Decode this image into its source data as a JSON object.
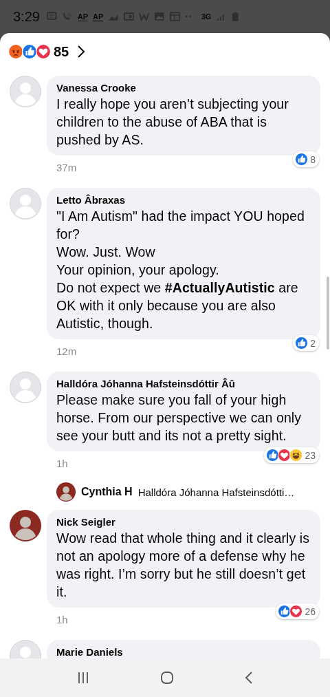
{
  "status_bar": {
    "time": "3:29",
    "ap_labels": [
      "AP",
      "AP"
    ],
    "network": "3G"
  },
  "header": {
    "reactions": [
      {
        "kind": "angry"
      },
      {
        "kind": "like"
      },
      {
        "kind": "love"
      }
    ],
    "count": "85"
  },
  "comments": [
    {
      "author": "Vanessa Crooke",
      "avatar": {
        "kind": "default"
      },
      "text": "I really hope you aren’t subjecting your children to the abuse of ABA that is pushed by AS.",
      "time": "37m",
      "reactions": [
        {
          "kind": "like"
        }
      ],
      "reaction_count": "8"
    },
    {
      "author": "Letto Âbraxas",
      "avatar": {
        "kind": "default"
      },
      "text": "\"I Am Autism\" had the impact YOU hoped for?\nWow. Just. Wow\nYour opinion, your apology.\nDo not expect we **#ActuallyAutistic** are OK with it only because you are also Autistic, though.",
      "time": "12m",
      "reactions": [
        {
          "kind": "like"
        }
      ],
      "reaction_count": "2"
    },
    {
      "author": "Halldóra Jóhanna Hafsteinsdóttir Âû",
      "avatar": {
        "kind": "default"
      },
      "text": "Please make sure you fall of your high horse. From our perspective we can only see your butt and its not a pretty sight.",
      "time": "1h",
      "reactions": [
        {
          "kind": "like"
        },
        {
          "kind": "love"
        },
        {
          "kind": "haha"
        }
      ],
      "reaction_count": "23",
      "reply": {
        "author": "Cynthia H",
        "avatar": {
          "kind": "photo"
        },
        "text": "Halldóra Jóhanna Hafsteinsdótti…"
      }
    },
    {
      "author": "Nick Seigler",
      "avatar": {
        "kind": "photo"
      },
      "text": "Wow read that whole thing and it clearly is not an apology more of a defense why he was right. I’m sorry but he still doesn’t get it.",
      "time": "1h",
      "reactions": [
        {
          "kind": "like"
        },
        {
          "kind": "love"
        }
      ],
      "reaction_count": "26"
    },
    {
      "author": "Marie Daniels",
      "avatar": {
        "kind": "default"
      }
    }
  ]
}
